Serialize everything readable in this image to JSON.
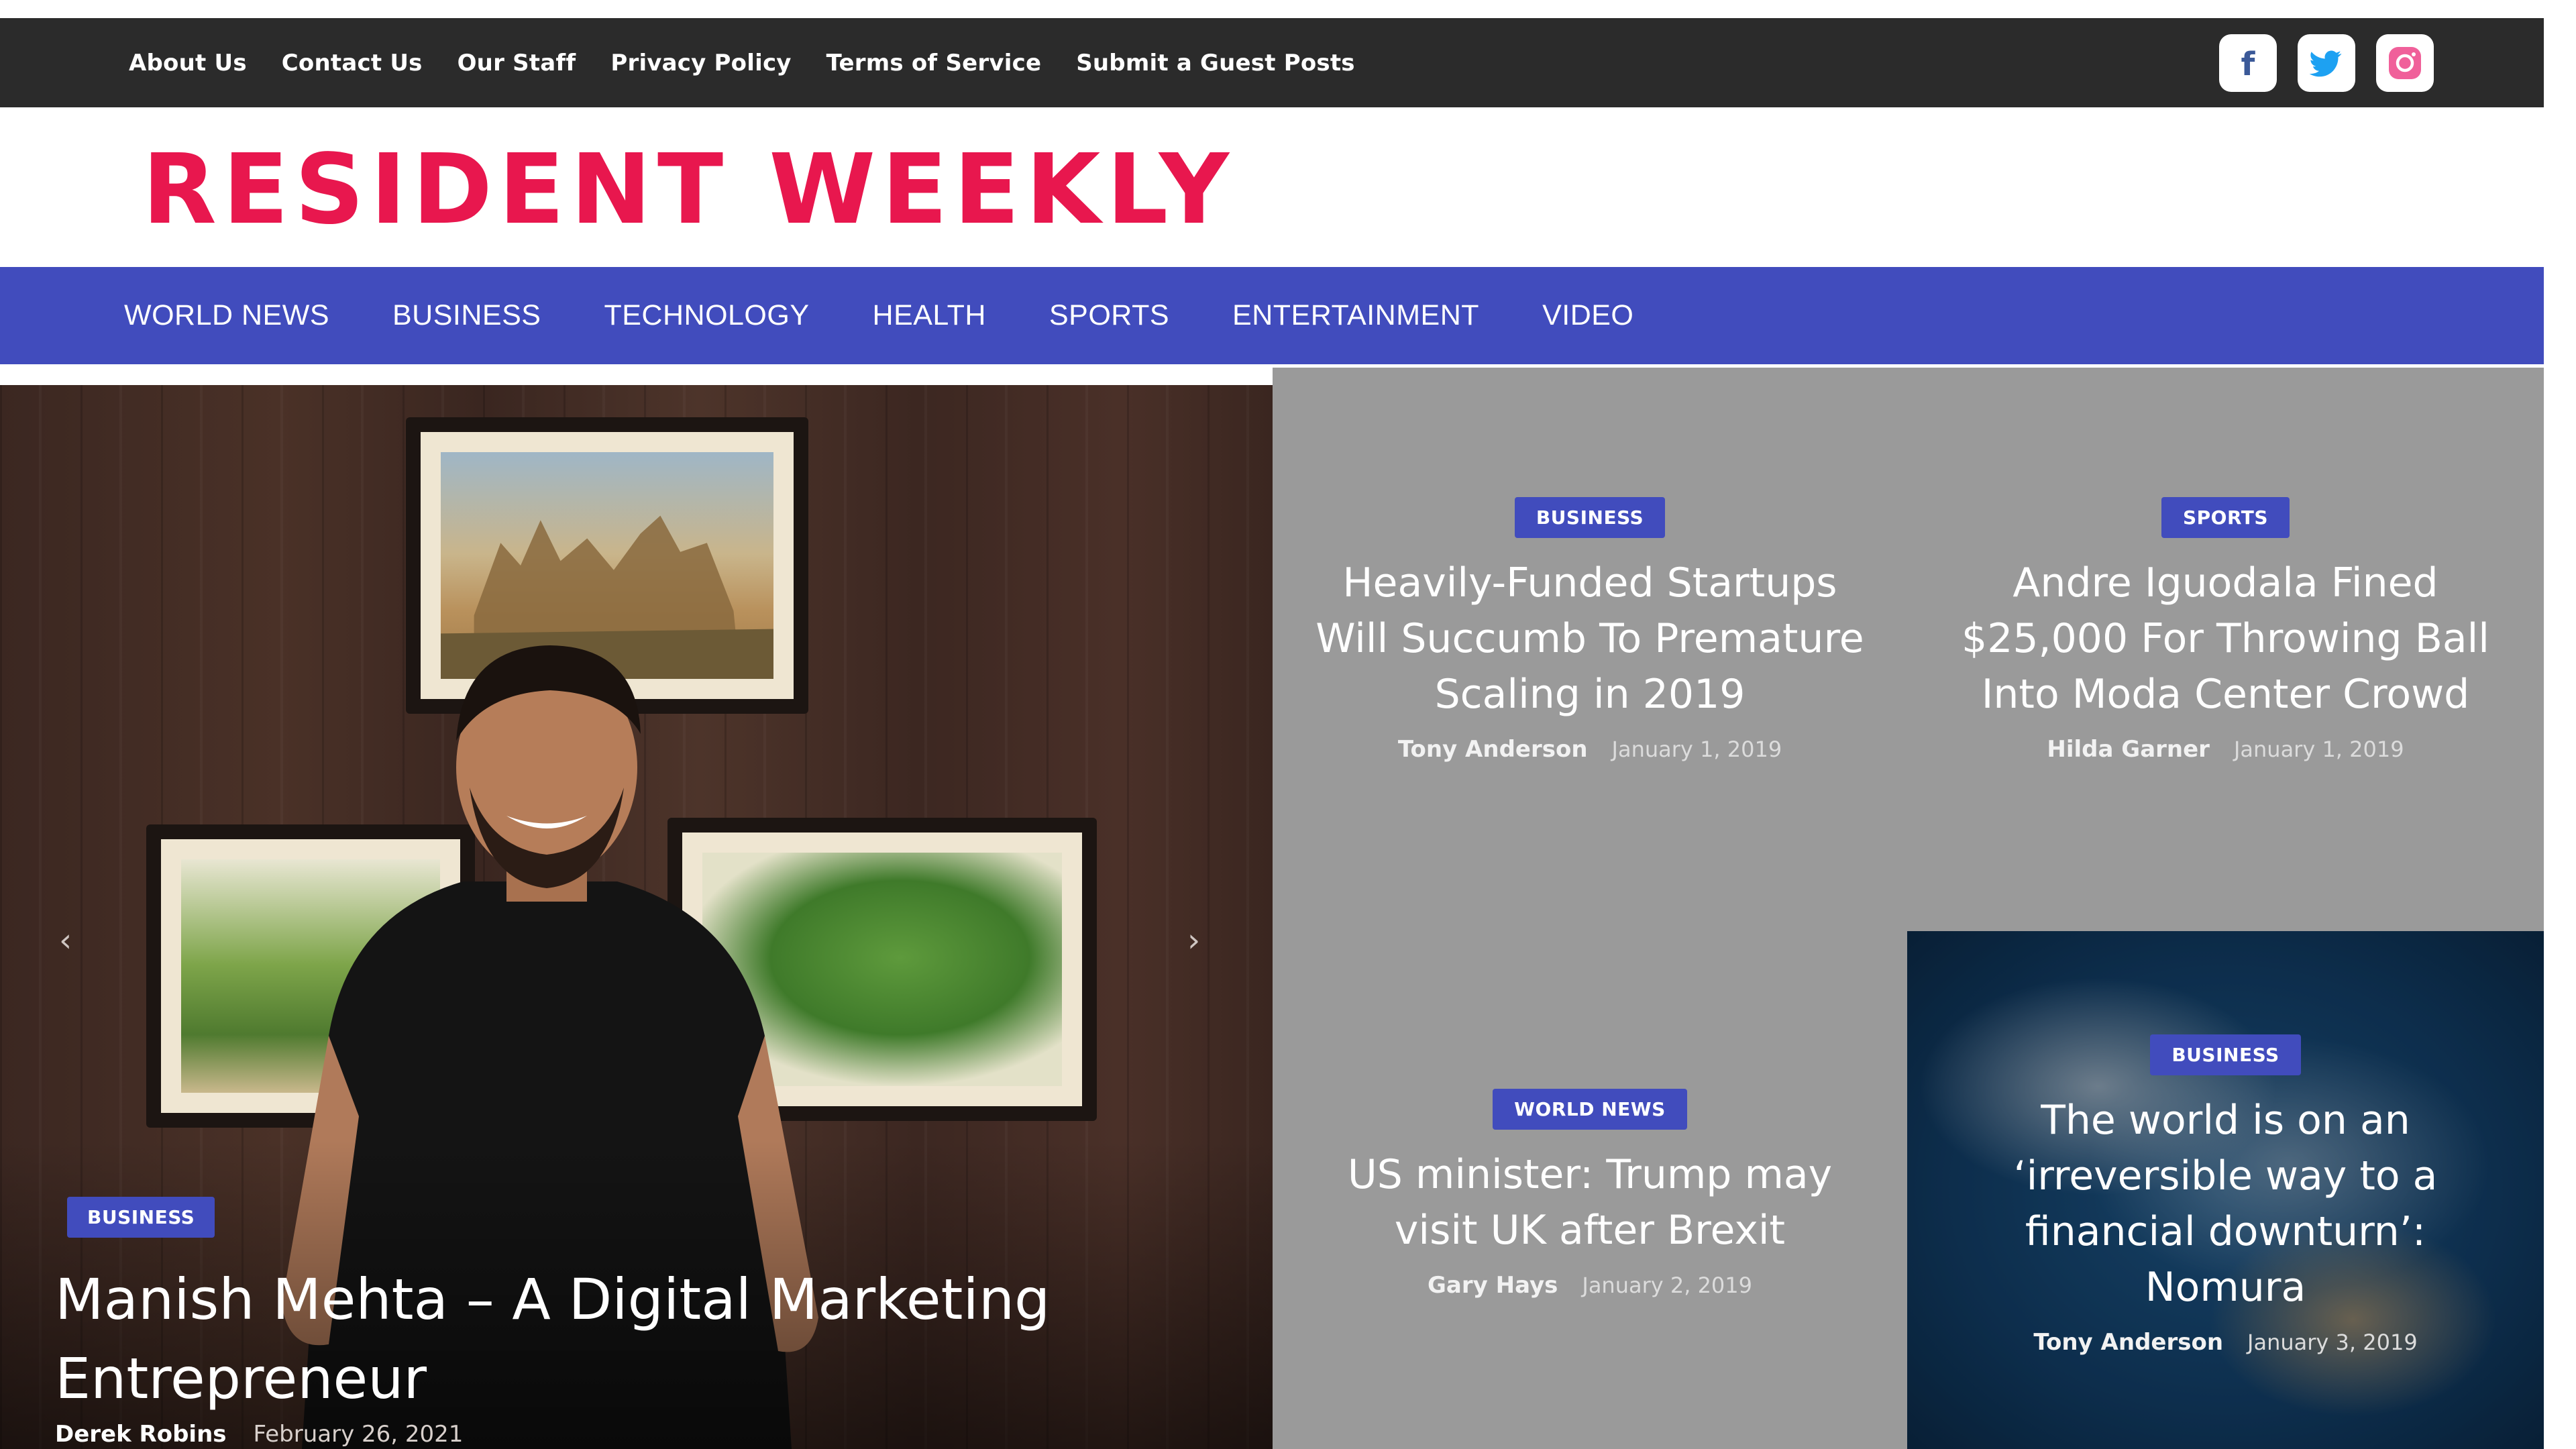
{
  "topbar": {
    "links": [
      "About Us",
      "Contact Us",
      "Our Staff",
      "Privacy Policy",
      "Terms of Service",
      "Submit a Guest Posts"
    ],
    "social": {
      "facebook": "f",
      "twitter_icon": "twitter-icon",
      "instagram_icon": "instagram-icon"
    }
  },
  "logo": {
    "text": "RESIDENT WEEKLY",
    "color": "#e8174e"
  },
  "nav": {
    "items": [
      "WORLD NEWS",
      "BUSINESS",
      "TECHNOLOGY",
      "HEALTH",
      "SPORTS",
      "ENTERTAINMENT",
      "VIDEO"
    ],
    "color": "#414cbd"
  },
  "hero": {
    "category": "BUSINESS",
    "title": "Manish Mehta – A Digital Marketing Entrepreneur",
    "author": "Derek Robins",
    "date": "February 26, 2021",
    "prev_arrow": "‹",
    "next_arrow": "›"
  },
  "cards": [
    {
      "category": "BUSINESS",
      "title": "Heavily-Funded Startups Will Succumb To Premature Scaling in 2019",
      "author": "Tony Anderson",
      "date": "January 1, 2019"
    },
    {
      "category": "SPORTS",
      "title": "Andre Iguodala Fined $25,000 For Throwing Ball Into Moda Center Crowd",
      "author": "Hilda Garner",
      "date": "January 1, 2019"
    },
    {
      "category": "WORLD NEWS",
      "title": "US minister: Trump may visit UK after Brexit",
      "author": "Gary Hays",
      "date": "January 2, 2019"
    },
    {
      "category": "BUSINESS",
      "title": "The world is on an ‘irreversible way to a financial downturn’: Nomura",
      "author": "Tony Anderson",
      "date": "January 3, 2019"
    }
  ]
}
